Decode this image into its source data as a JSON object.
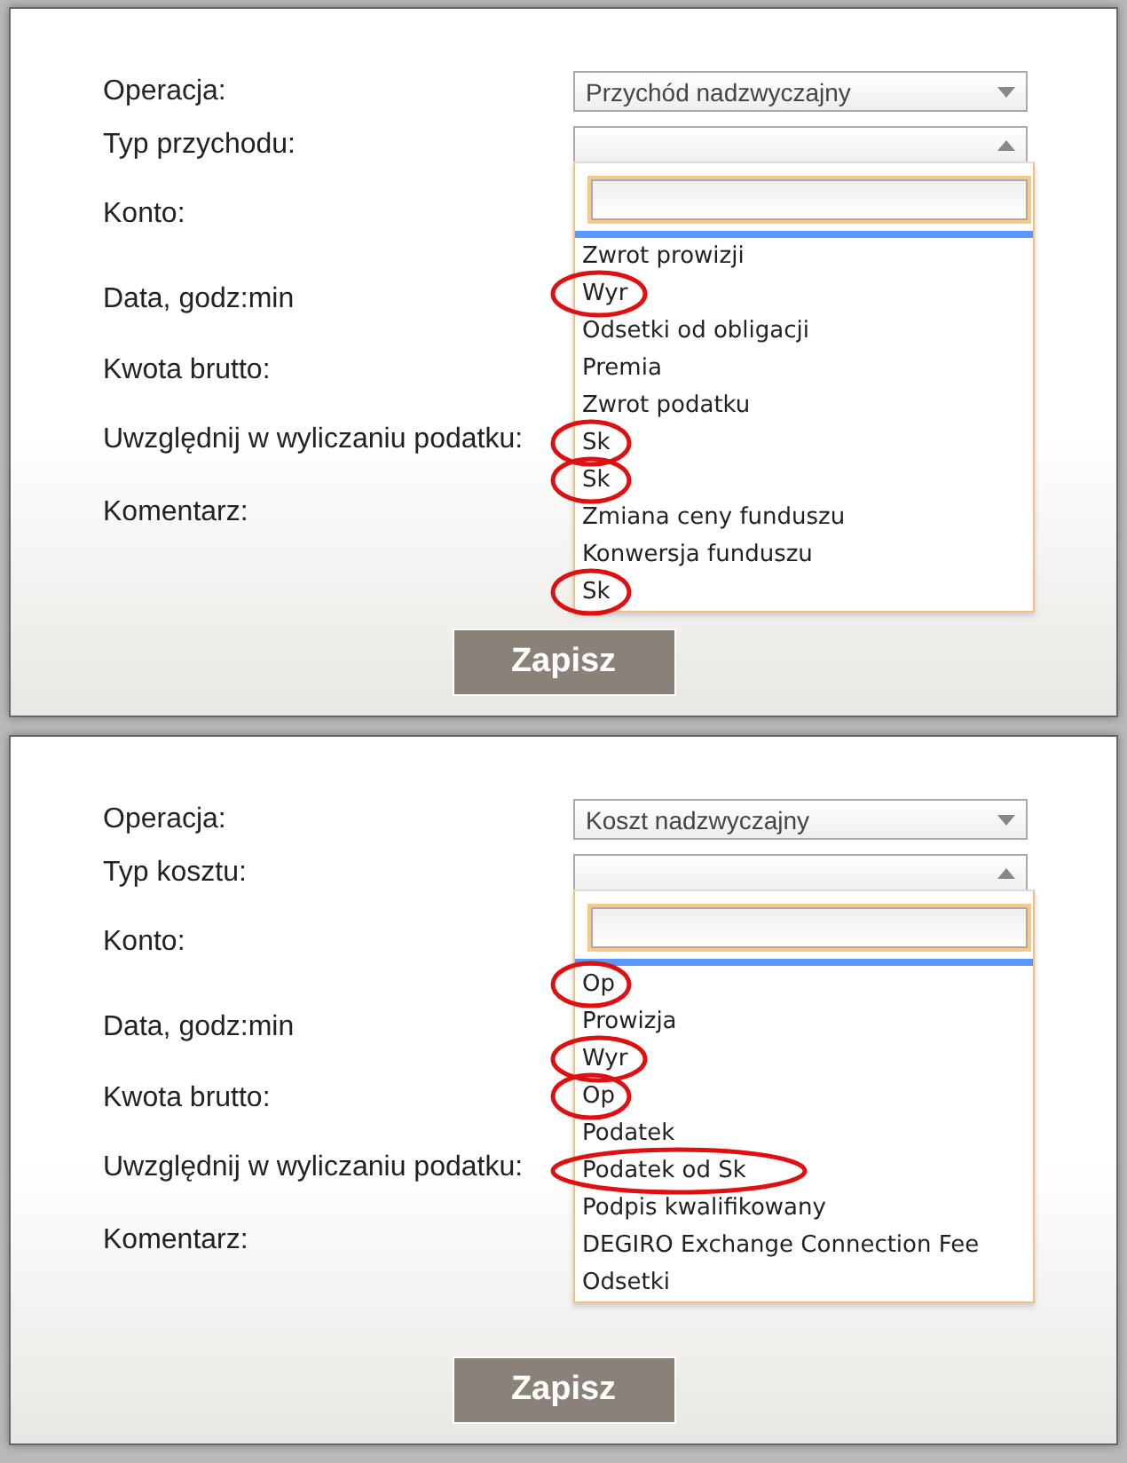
{
  "panels": [
    {
      "rows": [
        {
          "label": "Operacja:",
          "kind": "select",
          "value": "Przychód nadzwyczajny",
          "open": false
        },
        {
          "label": "Typ przychodu:",
          "kind": "select",
          "value": "",
          "open": true
        },
        {
          "label": "Konto:",
          "kind": "text"
        },
        {
          "label": "Data, godz:min",
          "kind": "text"
        },
        {
          "label": "Kwota brutto:",
          "kind": "text"
        },
        {
          "label": "Uwzględnij w wyliczaniu podatku:",
          "kind": "text"
        },
        {
          "label": "Komentarz:",
          "kind": "text"
        }
      ],
      "dropdown": {
        "options": [
          {
            "text": "Zwrot prowizji",
            "circled": false
          },
          {
            "text": "Wyr",
            "circled": true
          },
          {
            "text": "Odsetki od obligacji",
            "circled": false
          },
          {
            "text": "Premia",
            "circled": false
          },
          {
            "text": "Zwrot podatku",
            "circled": false
          },
          {
            "text": "Sk",
            "circled": true
          },
          {
            "text": "Sk",
            "circled": true
          },
          {
            "text": "Zmiana ceny funduszu",
            "circled": false
          },
          {
            "text": "Konwersja funduszu",
            "circled": false
          },
          {
            "text": "Sk",
            "circled": true
          }
        ]
      },
      "button": "Zapisz"
    },
    {
      "rows": [
        {
          "label": "Operacja:",
          "kind": "select",
          "value": "Koszt nadzwyczajny",
          "open": false
        },
        {
          "label": "Typ kosztu:",
          "kind": "select",
          "value": "",
          "open": true
        },
        {
          "label": "Konto:",
          "kind": "text"
        },
        {
          "label": "Data, godz:min",
          "kind": "text"
        },
        {
          "label": "Kwota brutto:",
          "kind": "text"
        },
        {
          "label": "Uwzględnij w wyliczaniu podatku:",
          "kind": "text"
        },
        {
          "label": "Komentarz:",
          "kind": "text"
        }
      ],
      "dropdown": {
        "options": [
          {
            "text": "Op",
            "circled": true
          },
          {
            "text": "Prowizja",
            "circled": false
          },
          {
            "text": "Wyr",
            "circled": true
          },
          {
            "text": "Op",
            "circled": true
          },
          {
            "text": "Podatek",
            "circled": false
          },
          {
            "text": "Podatek od Sk",
            "circled": true
          },
          {
            "text": "Podpis kwalifikowany",
            "circled": false
          },
          {
            "text": "DEGIRO Exchange Connection Fee",
            "circled": false
          },
          {
            "text": "Odsetki",
            "circled": false
          }
        ]
      },
      "button": "Zapisz"
    }
  ]
}
